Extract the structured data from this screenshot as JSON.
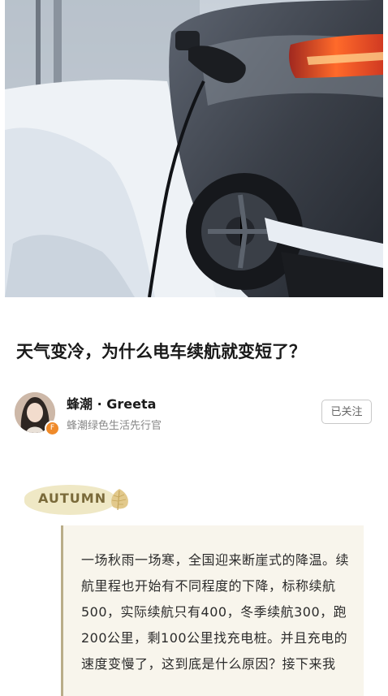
{
  "article": {
    "title": "天气变冷，为什么电车续航就变短了？"
  },
  "author": {
    "name": "蜂潮 · Greeta",
    "subtitle": "蜂潮绿色生活先行官",
    "badge": "F",
    "follow_label": "已关注"
  },
  "section": {
    "tag": "AUTUMN"
  },
  "intro": {
    "text": "一场秋雨一场寒，全国迎来断崖式的降温。续航里程也开始有不同程度的下降，标称续航500，实际续航只有400，冬季续航300，跑200公里，剩100公里找充电桩。并且充电的速度变慢了，这到底是什么原因？接下来我"
  },
  "colors": {
    "tag_bg": "#efe8c5",
    "quote_bg": "#f8f5ec",
    "quote_border": "#b9ad88",
    "badge": "#ef8a2a"
  }
}
